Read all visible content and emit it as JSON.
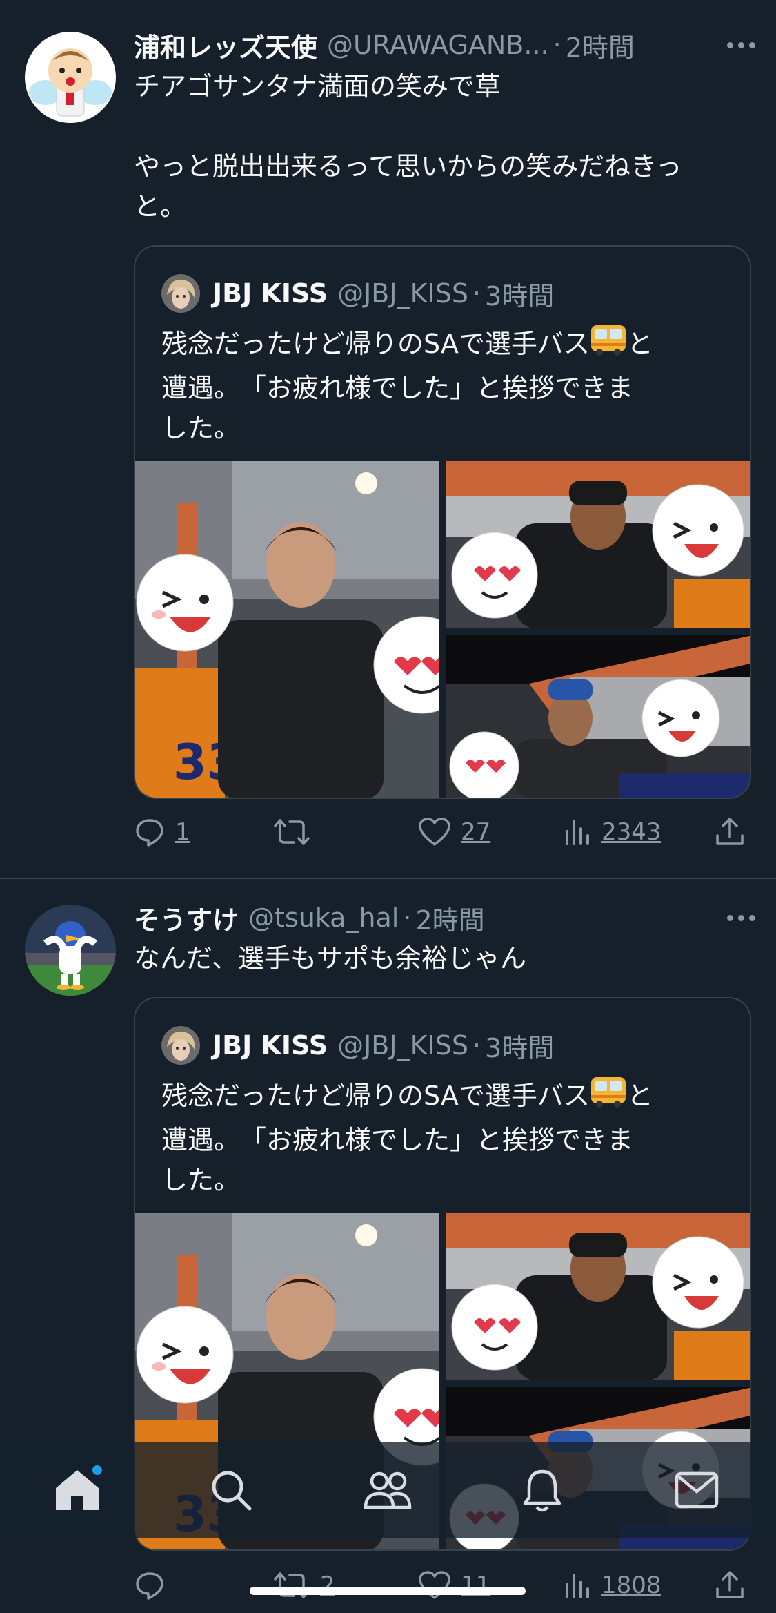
{
  "tweets": [
    {
      "name": "浦和レッズ天使",
      "handle": "@URAWAGANB...",
      "time": "2時間",
      "text": "チアゴサンタナ満面の笑みで草\n\nやっと脱出出来るって思いからの笑みだねきっ\nと。",
      "quote": {
        "name": "JBJ KISS",
        "handle": "@JBJ_KISS",
        "time": "3時間",
        "text_before": "残念だったけど帰りのSAで選手バス",
        "text_after": "と\n遭遇。　「お疲れ様でした」と挨拶できま\nした。"
      },
      "actions": {
        "reply": "1",
        "retweet": "",
        "like": "27",
        "views": "2343"
      }
    },
    {
      "name": "そうすけ",
      "handle": "@tsuka_hal",
      "time": "2時間",
      "text": "なんだ、選手もサポも余裕じゃん",
      "quote": {
        "name": "JBJ KISS",
        "handle": "@JBJ_KISS",
        "time": "3時間",
        "text_before": "残念だったけど帰りのSAで選手バス",
        "text_after": "と\n遭遇。　「お疲れ様でした」と挨拶できま\nした。"
      },
      "actions": {
        "reply": "",
        "retweet": "2",
        "like": "11",
        "views": "1808"
      }
    }
  ],
  "separator": "·",
  "icons": {
    "more": "more-icon",
    "reply": "reply-icon",
    "retweet": "retweet-icon",
    "like": "heart-icon",
    "views": "views-icon",
    "share": "share-icon",
    "bus": "bus-emoji"
  },
  "nav": [
    "home-icon",
    "search-icon",
    "communities-icon",
    "notifications-icon",
    "messages-icon"
  ],
  "colors": {
    "background": "#15202b",
    "secondary_text": "#8b98a5",
    "accent": "#1d9bf0",
    "border": "#38444d"
  }
}
